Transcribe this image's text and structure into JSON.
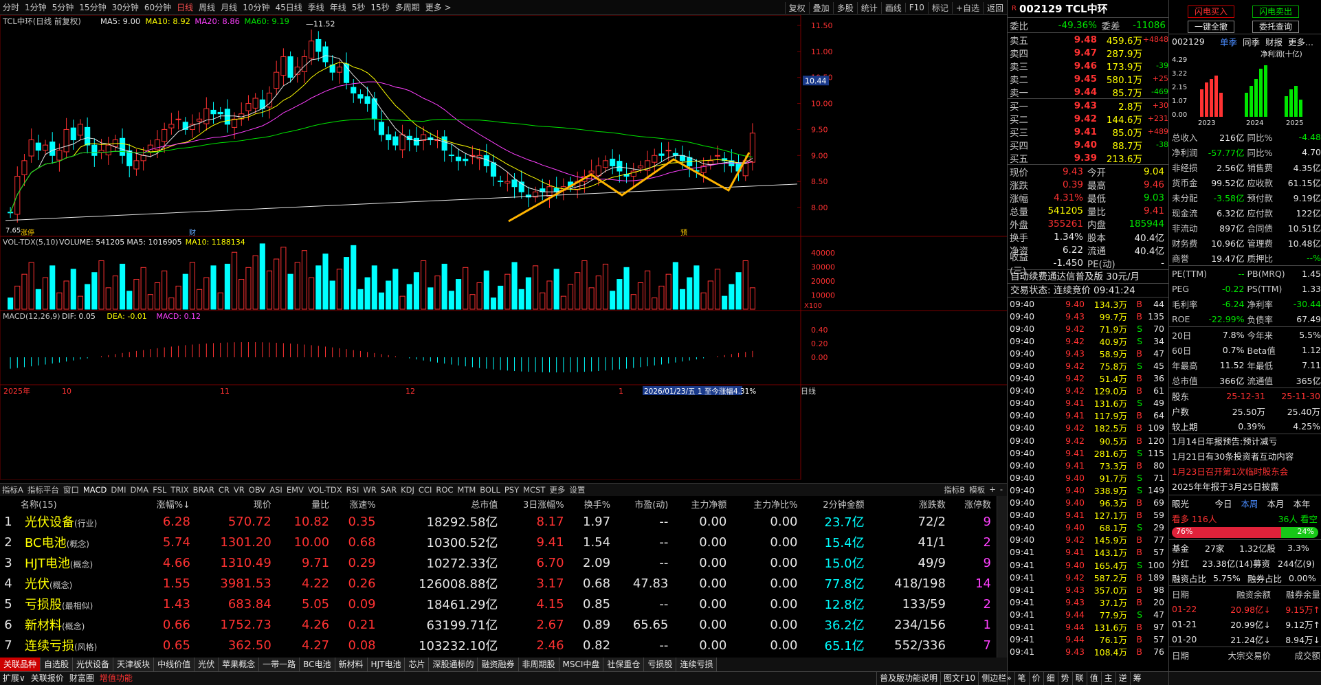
{
  "toolbar": {
    "periods": [
      "分时",
      "1分钟",
      "5分钟",
      "15分钟",
      "30分钟",
      "60分钟",
      "日线",
      "周线",
      "月线",
      "10分钟",
      "45日线",
      "季线",
      "年线",
      "5秒",
      "15秒",
      "多周期",
      "更多 >"
    ],
    "active": "日线",
    "right_buttons": [
      "复权",
      "叠加",
      "多股",
      "统计",
      "画线",
      "F10",
      "标记",
      "+自选",
      "返回"
    ]
  },
  "chart": {
    "title": "TCL中环(日线 前复权)",
    "ma_legend": [
      {
        "label": "MA5: 9.00",
        "color": "#e6e6e6"
      },
      {
        "label": "MA10: 8.92",
        "color": "#ffff00"
      },
      {
        "label": "MA20: 8.86",
        "color": "#ff40ff"
      },
      {
        "label": "MA60: 9.19",
        "color": "#00e600"
      }
    ],
    "high_label": "11.52",
    "low_label": "7.65",
    "current_price_tag": "10.44",
    "price_ticks": [
      "11.50",
      "11.00",
      "10.50",
      "10.00",
      "9.50",
      "9.00",
      "8.50",
      "8.00"
    ],
    "markers": [
      "涨停",
      "财",
      "预"
    ],
    "vol_title": "VOL-TDX(5,10)",
    "vol_legend": [
      {
        "label": "VOLUME: 541205",
        "color": "#e6e6e6"
      },
      {
        "label": "MA5: 1016905",
        "color": "#e6e6e6"
      },
      {
        "label": "MA10: 1188134",
        "color": "#ffff00"
      }
    ],
    "vol_ticks": [
      "40000",
      "30000",
      "20000",
      "10000"
    ],
    "vol_unit": "X100",
    "macd_title": "MACD(12,26,9)",
    "macd_legend": [
      {
        "label": "DIF: 0.05",
        "color": "#e6e6e6"
      },
      {
        "label": "DEA: -0.01",
        "color": "#ffff00"
      },
      {
        "label": "MACD: 0.12",
        "color": "#ff40ff"
      }
    ],
    "macd_ticks": [
      "0.40",
      "0.20",
      "0.00"
    ],
    "date_labels": [
      "2025年",
      "10",
      "11",
      "12",
      "1"
    ],
    "date_info": "2026/01/23/五 1 至今涨幅4.31%",
    "date_right": "日线"
  },
  "indicator_tabs": [
    "指标A",
    "指标平台",
    "窗口",
    "MACD",
    "DMI",
    "DMA",
    "FSL",
    "TRIX",
    "BRAR",
    "CR",
    "VR",
    "OBV",
    "ASI",
    "EMV",
    "VOL-TDX",
    "RSI",
    "WR",
    "SAR",
    "KDJ",
    "CCI",
    "ROC",
    "MTM",
    "BOLL",
    "PSY",
    "MCST",
    "更多",
    "设置"
  ],
  "indicator_right": [
    "指标B",
    "模板",
    "+",
    "-"
  ],
  "table": {
    "headers": [
      "名称(15)",
      "涨幅%↓",
      "现价",
      "量比",
      "涨速%",
      "总市值",
      "3日涨幅%",
      "换手%",
      "市盈(动)",
      "主力净额",
      "主力净比%",
      "2分钟金额",
      "涨跌数",
      "涨停数"
    ],
    "rows": [
      {
        "idx": "1",
        "name": "光伏设备",
        "tag": "(行业)",
        "chg": "6.28",
        "price": "570.72",
        "vr": "10.82",
        "spd": "0.35",
        "cap": "18292.58亿",
        "d3": "8.17",
        "turn": "1.97",
        "pe": "--",
        "main": "0.00",
        "mainr": "0.00",
        "amt2": "23.7亿",
        "ud": "72/2",
        "lim": "9"
      },
      {
        "idx": "2",
        "name": "BC电池",
        "tag": "(概念)",
        "chg": "5.74",
        "price": "1301.20",
        "vr": "10.00",
        "spd": "0.68",
        "cap": "10300.52亿",
        "d3": "9.41",
        "turn": "1.54",
        "pe": "--",
        "main": "0.00",
        "mainr": "0.00",
        "amt2": "15.4亿",
        "ud": "41/1",
        "lim": "2"
      },
      {
        "idx": "3",
        "name": "HJT电池",
        "tag": "(概念)",
        "chg": "4.66",
        "price": "1310.49",
        "vr": "9.71",
        "spd": "0.29",
        "cap": "10272.33亿",
        "d3": "6.70",
        "turn": "2.09",
        "pe": "--",
        "main": "0.00",
        "mainr": "0.00",
        "amt2": "15.0亿",
        "ud": "49/9",
        "lim": "9"
      },
      {
        "idx": "4",
        "name": "光伏",
        "tag": "(概念)",
        "chg": "1.55",
        "price": "3981.53",
        "vr": "4.22",
        "spd": "0.26",
        "cap": "126008.88亿",
        "d3": "3.17",
        "turn": "0.68",
        "pe": "47.83",
        "main": "0.00",
        "mainr": "0.00",
        "amt2": "77.8亿",
        "ud": "418/198",
        "lim": "14"
      },
      {
        "idx": "5",
        "name": "亏损股",
        "tag": "(最相似)",
        "chg": "1.43",
        "price": "683.84",
        "vr": "5.05",
        "spd": "0.09",
        "cap": "18461.29亿",
        "d3": "4.15",
        "turn": "0.85",
        "pe": "--",
        "main": "0.00",
        "mainr": "0.00",
        "amt2": "12.8亿",
        "ud": "133/59",
        "lim": "2"
      },
      {
        "idx": "6",
        "name": "新材料",
        "tag": "(概念)",
        "chg": "0.66",
        "price": "1752.73",
        "vr": "4.26",
        "spd": "0.21",
        "cap": "63199.71亿",
        "d3": "2.67",
        "turn": "0.89",
        "pe": "65.65",
        "main": "0.00",
        "mainr": "0.00",
        "amt2": "36.2亿",
        "ud": "234/156",
        "lim": "1"
      },
      {
        "idx": "7",
        "name": "连续亏损",
        "tag": "(风格)",
        "chg": "0.65",
        "price": "362.50",
        "vr": "4.27",
        "spd": "0.08",
        "cap": "103232.10亿",
        "d3": "2.46",
        "turn": "0.82",
        "pe": "--",
        "main": "0.00",
        "mainr": "0.00",
        "amt2": "65.1亿",
        "ud": "552/336",
        "lim": "7"
      }
    ]
  },
  "sector_tabs": [
    "关联品种",
    "自选股",
    "光伏设备",
    "天津板块",
    "中线价值",
    "光伏",
    "苹果概念",
    "一带一路",
    "BC电池",
    "新材料",
    "HJT电池",
    "芯片",
    "深股通标的",
    "融资融券",
    "非周期股",
    "MSCI中盘",
    "社保重仓",
    "亏损股",
    "连续亏损"
  ],
  "bottom_left": [
    "扩展∨",
    "关联报价",
    "财富圈",
    "增值功能"
  ],
  "bottom_right": [
    "普及版功能说明",
    "图文F10",
    "侧边栏»",
    "笔",
    "价",
    "细",
    "势",
    "联",
    "值",
    "主",
    "逆",
    "筹"
  ],
  "quote": {
    "code": "002129 TCL中环",
    "wb_label": "委比",
    "wb": "-49.36%",
    "wc_label": "委差",
    "wc": "-11086",
    "asks": [
      {
        "l": "卖五",
        "p": "9.48",
        "v": "459.6万",
        "d": "+4848"
      },
      {
        "l": "卖四",
        "p": "9.47",
        "v": "287.9万",
        "d": ""
      },
      {
        "l": "卖三",
        "p": "9.46",
        "v": "173.9万",
        "d": "-39"
      },
      {
        "l": "卖二",
        "p": "9.45",
        "v": "580.1万",
        "d": "+25"
      },
      {
        "l": "卖一",
        "p": "9.44",
        "v": "85.7万",
        "d": "-469"
      }
    ],
    "bids": [
      {
        "l": "买一",
        "p": "9.43",
        "v": "2.8万",
        "d": "+30"
      },
      {
        "l": "买二",
        "p": "9.42",
        "v": "144.6万",
        "d": "+231"
      },
      {
        "l": "买三",
        "p": "9.41",
        "v": "85.0万",
        "d": "+489"
      },
      {
        "l": "买四",
        "p": "9.40",
        "v": "88.7万",
        "d": "-38"
      },
      {
        "l": "买五",
        "p": "9.39",
        "v": "213.6万",
        "d": ""
      }
    ],
    "stats": [
      [
        "现价",
        "9.43",
        "今开",
        "9.04"
      ],
      [
        "涨跌",
        "0.39",
        "最高",
        "9.46"
      ],
      [
        "涨幅",
        "4.31%",
        "最低",
        "9.03"
      ],
      [
        "总量",
        "541205",
        "量比",
        "9.41"
      ],
      [
        "外盘",
        "355261",
        "内盘",
        "185944"
      ],
      [
        "换手",
        "1.34%",
        "股本",
        "40.4亿"
      ],
      [
        "净资",
        "6.22",
        "流通",
        "40.4亿"
      ],
      [
        "收益(三)",
        "-1.450",
        "PE(动)",
        "-"
      ]
    ],
    "ad": "自动续费通达信普及版 30元/月",
    "status": "交易状态: 连续竞价 09:41:24",
    "ticks": [
      [
        "09:40",
        "9.40",
        "134.3万",
        "B",
        "44"
      ],
      [
        "09:40",
        "9.43",
        "99.7万",
        "B",
        "135"
      ],
      [
        "09:40",
        "9.42",
        "71.9万",
        "S",
        "70"
      ],
      [
        "09:40",
        "9.42",
        "40.9万",
        "S",
        "34"
      ],
      [
        "09:40",
        "9.43",
        "58.9万",
        "B",
        "47"
      ],
      [
        "09:40",
        "9.42",
        "75.8万",
        "S",
        "45"
      ],
      [
        "09:40",
        "9.42",
        "51.4万",
        "B",
        "36"
      ],
      [
        "09:40",
        "9.42",
        "129.0万",
        "B",
        "61"
      ],
      [
        "09:40",
        "9.41",
        "131.6万",
        "S",
        "49"
      ],
      [
        "09:40",
        "9.41",
        "117.9万",
        "B",
        "64"
      ],
      [
        "09:40",
        "9.42",
        "182.5万",
        "B",
        "109"
      ],
      [
        "09:40",
        "9.42",
        "90.5万",
        "B",
        "120"
      ],
      [
        "09:40",
        "9.41",
        "281.6万",
        "S",
        "115"
      ],
      [
        "09:40",
        "9.41",
        "73.3万",
        "B",
        "80"
      ],
      [
        "09:40",
        "9.40",
        "91.7万",
        "S",
        "71"
      ],
      [
        "09:40",
        "9.40",
        "338.9万",
        "S",
        "149"
      ],
      [
        "09:40",
        "9.40",
        "96.3万",
        "B",
        "69"
      ],
      [
        "09:40",
        "9.41",
        "127.1万",
        "B",
        "59"
      ],
      [
        "09:40",
        "9.40",
        "68.1万",
        "S",
        "29"
      ],
      [
        "09:40",
        "9.42",
        "145.9万",
        "B",
        "77"
      ],
      [
        "09:41",
        "9.41",
        "143.1万",
        "B",
        "57"
      ],
      [
        "09:41",
        "9.40",
        "165.4万",
        "S",
        "100"
      ],
      [
        "09:41",
        "9.42",
        "587.2万",
        "B",
        "189"
      ],
      [
        "09:41",
        "9.43",
        "357.0万",
        "B",
        "98"
      ],
      [
        "09:41",
        "9.43",
        "37.1万",
        "B",
        "20"
      ],
      [
        "09:41",
        "9.44",
        "77.9万",
        "S",
        "47"
      ],
      [
        "09:41",
        "9.44",
        "131.6万",
        "B",
        "97"
      ],
      [
        "09:41",
        "9.44",
        "76.1万",
        "B",
        "57"
      ],
      [
        "09:41",
        "9.43",
        "108.4万",
        "B",
        "76"
      ]
    ]
  },
  "fin": {
    "buttons": [
      "闪电买入",
      "闪电卖出",
      "一键全撤",
      "委托查询"
    ],
    "code": "002129",
    "tabs": [
      "单季",
      "同季",
      "财报",
      "更多..."
    ],
    "chart_title": "净利润(十亿)",
    "chart_y": [
      "4.29",
      "3.22",
      "2.15",
      "1.07",
      "0.00"
    ],
    "chart_years": [
      "2023",
      "2024",
      "2025"
    ],
    "rows1": [
      [
        "总收入",
        "216亿",
        "同比%",
        "-4.48"
      ],
      [
        "净利润",
        "-57.77亿",
        "同比%",
        "4.70"
      ],
      [
        "非经损",
        "2.56亿",
        "销售费",
        "4.35亿"
      ],
      [
        "货币金",
        "99.52亿",
        "应收款",
        "61.15亿"
      ],
      [
        "未分配",
        "-3.58亿",
        "预付款",
        "9.19亿"
      ],
      [
        "现金流",
        "6.32亿",
        "应付款",
        "122亿"
      ],
      [
        "非流动",
        "897亿",
        "合同债",
        "10.51亿"
      ],
      [
        "财务费",
        "10.96亿",
        "管理费",
        "10.48亿"
      ],
      [
        "商誉",
        "19.47亿",
        "质押比",
        "--%"
      ]
    ],
    "rows2": [
      [
        "PE(TTM)",
        "--",
        "PB(MRQ)",
        "1.45"
      ],
      [
        "PEG",
        "-0.22",
        "PS(TTM)",
        "1.33"
      ],
      [
        "毛利率",
        "-6.24",
        "净利率",
        "-30.44"
      ],
      [
        "ROE",
        "-22.99%",
        "负债率",
        "67.49"
      ]
    ],
    "rows3": [
      [
        "20日",
        "7.8%",
        "今年来",
        "5.5%"
      ],
      [
        "60日",
        "0.7%",
        "Beta值",
        "1.12"
      ],
      [
        "年最高",
        "11.52",
        "年最低",
        "7.11"
      ],
      [
        "总市值",
        "366亿",
        "流通值",
        "365亿"
      ]
    ],
    "rows4": [
      [
        "股东",
        "25-12-31",
        "25-11-30"
      ],
      [
        "户数",
        "25.50万",
        "25.40万"
      ],
      [
        "较上期",
        "0.39%",
        "4.25%"
      ]
    ],
    "news": [
      "1月14日年报预告:预计减亏",
      "1月21日有30条投资者互动内容",
      "1月23日召开第1次临时股东会",
      "2025年年报于3月25日披露"
    ],
    "news_colors": [
      "#e6e6e6",
      "#e6e6e6",
      "#ff3232",
      "#e6e6e6"
    ],
    "sentiment_title": "眼光",
    "sent_tabs": [
      "今日",
      "本周",
      "本月",
      "本年"
    ],
    "bull": "看多 116人",
    "bear": "36人 看空",
    "bull_pct": "76%",
    "bear_pct": "24%",
    "fund": [
      "基金",
      "27家",
      "1.32亿股",
      "3.3%"
    ],
    "div": [
      "分红",
      "23.38亿(14)募资",
      "244亿(9)"
    ],
    "margin_ratio": [
      "融资占比",
      "5.75%",
      "融券占比",
      "0.00%"
    ],
    "margin_head": [
      "日期",
      "融资余额",
      "融券余量"
    ],
    "margin_rows": [
      [
        "01-22",
        "20.98亿↓",
        "9.15万↑"
      ],
      [
        "01-21",
        "20.99亿↓",
        "9.12万↑"
      ],
      [
        "01-20",
        "21.24亿↓",
        "8.94万↓"
      ]
    ],
    "block_head": [
      "日期",
      "大宗交易价",
      "成交额"
    ]
  }
}
